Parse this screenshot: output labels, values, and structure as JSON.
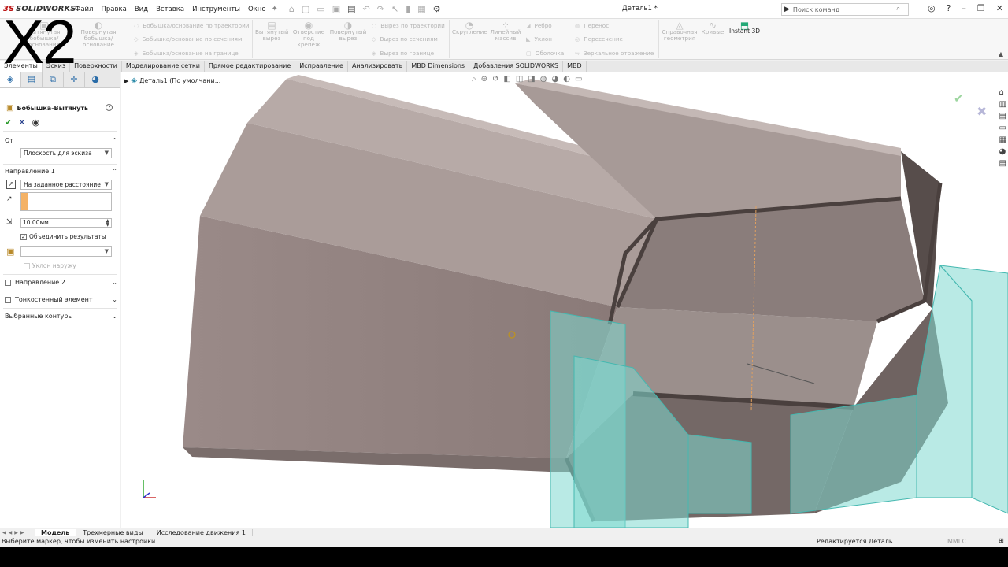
{
  "overlay": {
    "text": "X2"
  },
  "app": {
    "logo_ds": "3S",
    "logo_name": "SOLIDWORKS"
  },
  "menu": [
    "Файл",
    "Правка",
    "Вид",
    "Вставка",
    "Инструменты",
    "Окно"
  ],
  "document_title": "Деталь1 *",
  "search": {
    "placeholder": "Поиск команд"
  },
  "ribbon": {
    "extrude_boss": "Вытянутая бобышка/основание",
    "revolve_boss": "Повернутая бобышка/основание",
    "sweep_boss": "Бобышка/основание по траектории",
    "loft_boss": "Бобышка/основание по сечениям",
    "boundary_boss": "Бобышка/основание на границе",
    "extrude_cut": "Вытянутый вырез",
    "hole_wizard": "Отверстие под крепеж",
    "revolve_cut": "Повернутый вырез",
    "sweep_cut": "Вырез по траектории",
    "loft_cut": "Вырез по сечениям",
    "boundary_cut": "Вырез по границе",
    "fillet": "Скругление",
    "linear_pattern": "Линейный массив",
    "rib": "Ребро",
    "draft": "Уклон",
    "shell": "Оболочка",
    "wrap": "Перенос",
    "intersect": "Пересечение",
    "mirror": "Зеркальное отражение",
    "ref_geometry": "Справочная геометрия",
    "curves": "Кривые",
    "instant3d": "Instant 3D"
  },
  "tabs": [
    "Элементы",
    "Эскиз",
    "Поверхности",
    "Моделирование сетки",
    "Прямое редактирование",
    "Исправление",
    "Анализировать",
    "MBD Dimensions",
    "Добавления SOLIDWORKS",
    "MBD"
  ],
  "property_manager": {
    "title": "Бобышка-Вытянуть",
    "from_label": "От",
    "from_value": "Плоскость для эскиза",
    "dir1_label": "Направление 1",
    "dir1_type": "На заданное расстояние",
    "depth": "10.00мм",
    "merge_label": "Объединить результаты",
    "draft_out": "Уклон наружу",
    "dir2_label": "Направление 2",
    "thin_label": "Тонкостенный элемент",
    "contours_label": "Выбранные контуры"
  },
  "tree": {
    "root": "Деталь1  (По умолчани..."
  },
  "bottom_tabs": [
    "Модель",
    "Трехмерные виды",
    "Исследование движения 1"
  ],
  "status": {
    "hint": "Выберите маркер, чтобы изменить настройки",
    "editing": "Редактируется Деталь",
    "units": "ММГС"
  }
}
